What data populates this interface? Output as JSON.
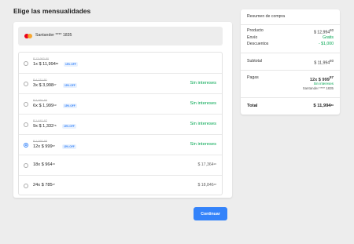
{
  "page": {
    "title": "Elige las mensualidades"
  },
  "card": {
    "label": "Santander **** 1835"
  },
  "options": [
    {
      "old_price": "$ 13,993.80",
      "count": "1x",
      "amount": "$ 11,994",
      "cents": "80",
      "badge": "15% OFF",
      "right_text": "",
      "right_cents": "",
      "right_type": "none",
      "selected": false
    },
    {
      "old_price": "$ 4,211.80",
      "count": "3x",
      "amount": "$ 3,998",
      "cents": "27",
      "badge": "15% OFF",
      "right_text": "Sin intereses",
      "right_cents": "",
      "right_type": "green",
      "selected": false
    },
    {
      "old_price": "$ 2,361.50",
      "count": "6x",
      "amount": "$ 1,999",
      "cents": "13",
      "badge": "15% OFF",
      "right_text": "Sin intereses",
      "right_cents": "",
      "right_type": "green",
      "selected": false
    },
    {
      "old_price": "$ 1,641.97",
      "count": "9x",
      "amount": "$ 1,332",
      "cents": "76",
      "badge": "15% OFF",
      "right_text": "Sin intereses",
      "right_cents": "",
      "right_type": "green",
      "selected": false
    },
    {
      "old_price": "$ 1,060.98",
      "count": "12x",
      "amount": "$ 999",
      "cents": "57",
      "badge": "15% OFF",
      "right_text": "Sin intereses",
      "right_cents": "",
      "right_type": "green",
      "selected": true
    },
    {
      "old_price": "",
      "count": "18x",
      "amount": "$ 964",
      "cents": "72",
      "badge": "",
      "right_text": "$ 17,364",
      "right_cents": "96",
      "right_type": "plain",
      "selected": false
    },
    {
      "old_price": "",
      "count": "24x",
      "amount": "$ 785",
      "cents": "27",
      "badge": "",
      "right_text": "$ 18,846",
      "right_cents": "48",
      "right_type": "plain",
      "selected": false
    }
  ],
  "continue_label": "Continuar",
  "summary": {
    "title": "Resumen de compra",
    "product_label": "Producto",
    "product_value": "$ 12,994",
    "product_cents": "80",
    "shipping_label": "Envío",
    "shipping_value": "Gratis",
    "discounts_label": "Descuentos",
    "discounts_value": "- $1,000",
    "subtotal_label": "Subtotal",
    "subtotal_value": "$ 11,994",
    "subtotal_cents": "80",
    "pay_label": "Pagas",
    "pay_value": "12x $ 999",
    "pay_cents": "57",
    "pay_interest": "Sin intereses",
    "pay_card": "Santander **** 1835",
    "total_label": "Total",
    "total_value": "$ 11,994",
    "total_cents": "80"
  },
  "colors": {
    "accent": "#3483fa",
    "green": "#00a650",
    "background": "#ededed"
  }
}
